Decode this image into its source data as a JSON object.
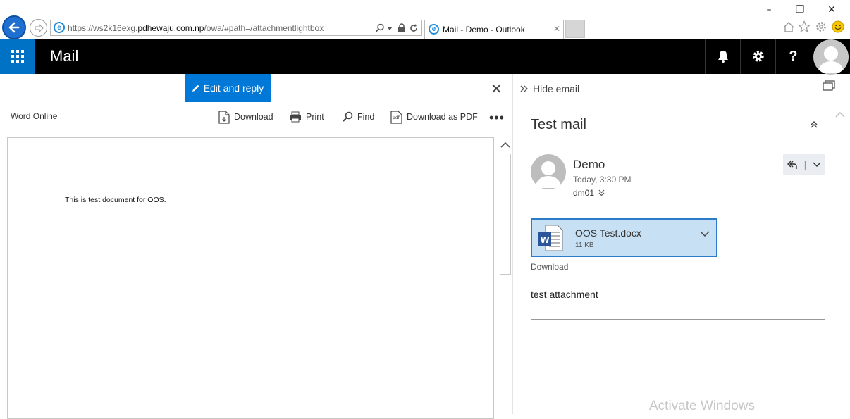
{
  "browser": {
    "url_prefix": "https://ws2k16exg.",
    "url_domain": "pdhewaju.com.np",
    "url_path": "/owa/#path=/attachmentlightbox",
    "tab_title": "Mail - Demo - Outlook",
    "window_buttons": {
      "minimize": "–",
      "restore": "❐",
      "close": "✕"
    }
  },
  "header": {
    "app_name": "Mail",
    "bell_icon": "bell-icon",
    "settings_icon": "gear-icon",
    "help_label": "?"
  },
  "viewer": {
    "edit_reply_label": "Edit and reply",
    "close_label": "✕",
    "app_label": "Word Online",
    "toolbar": {
      "download": "Download",
      "print": "Print",
      "find": "Find",
      "download_pdf": "Download as PDF",
      "more": "•••"
    },
    "document_text": "This is test document for OOS."
  },
  "reading_pane": {
    "hide_email_label": "Hide email",
    "subject": "Test mail",
    "sender": "Demo",
    "time": "Today, 3:30 PM",
    "recipient": "dm01",
    "attachment": {
      "name": "OOS Test.docx",
      "size": "11 KB",
      "download_label": "Download"
    },
    "body": "test attachment"
  },
  "watermark": "Activate Windows",
  "colors": {
    "brand_blue": "#0078d7",
    "waffle_blue": "#0072c6",
    "header_bg": "#000000",
    "attachment_bg": "#c7e0f4",
    "attachment_border": "#2b7bc9"
  }
}
